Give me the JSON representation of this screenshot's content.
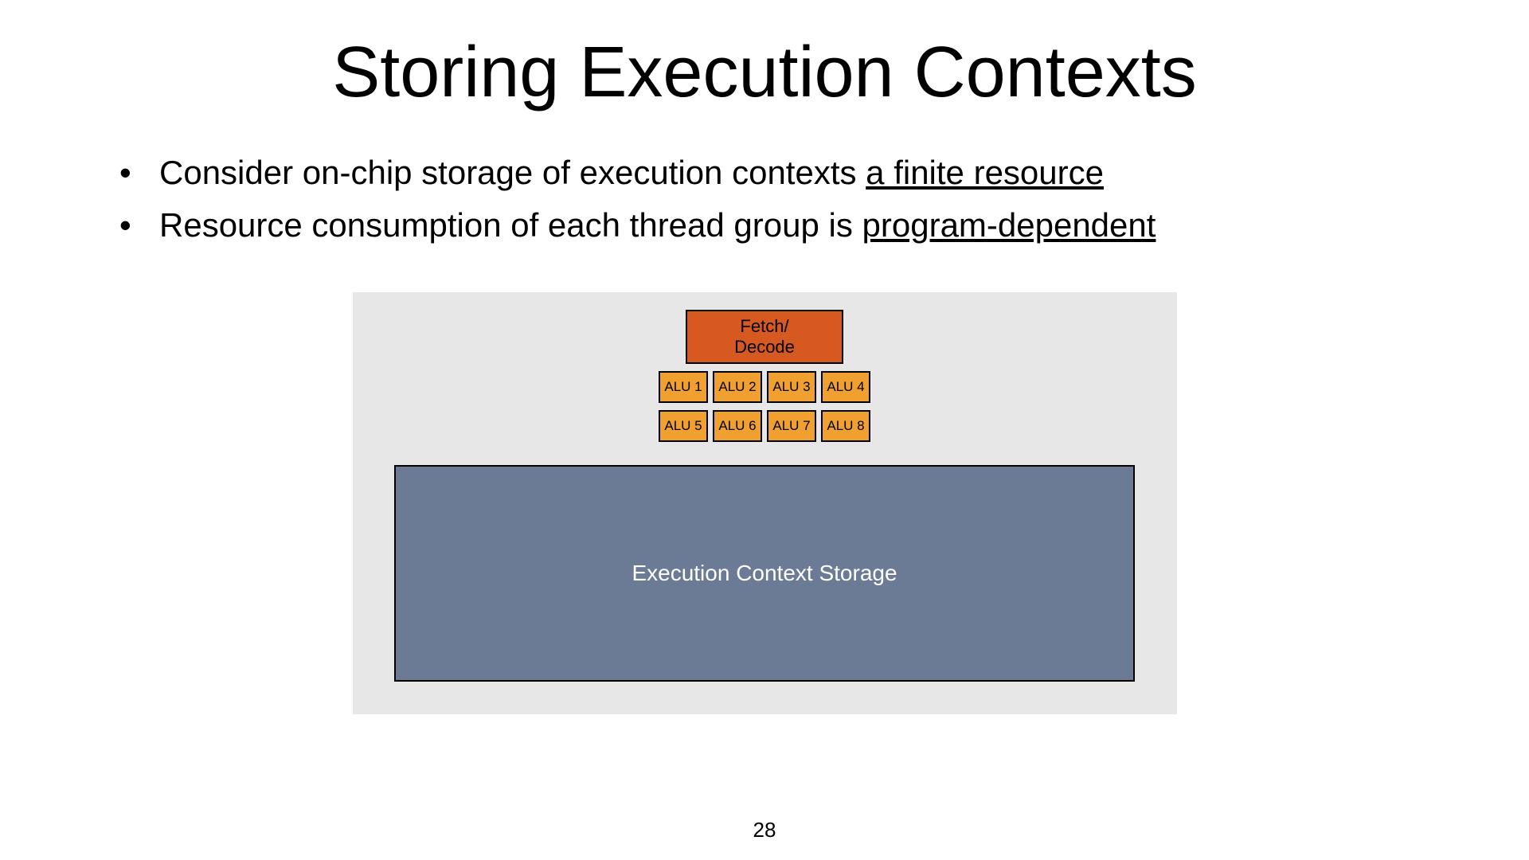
{
  "title": "Storing Execution Contexts",
  "bullets": [
    {
      "prefix": "Consider on-chip storage of execution contexts ",
      "underlined": "a finite resource"
    },
    {
      "prefix": "Resource consumption of each thread group is ",
      "underlined": "program-dependent"
    }
  ],
  "diagram": {
    "fetch_decode_line1": "Fetch/",
    "fetch_decode_line2": "Decode",
    "alus_row1": [
      "ALU 1",
      "ALU 2",
      "ALU 3",
      "ALU 4"
    ],
    "alus_row2": [
      "ALU 5",
      "ALU 6",
      "ALU 7",
      "ALU 8"
    ],
    "storage_label": "Execution Context Storage"
  },
  "page_number": "28"
}
